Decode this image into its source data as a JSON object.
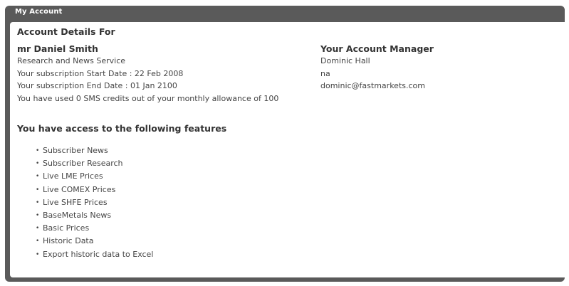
{
  "panel": {
    "header_title": "My Account"
  },
  "account": {
    "title": "Account Details For",
    "name": "mr Daniel Smith",
    "service": "Research and News Service",
    "start_date": "Your subscription Start Date : 22 Feb 2008",
    "end_date": "Your subscription End Date : 01 Jan 2100",
    "sms_credits": "You have used 0 SMS credits out of your monthly allowance of 100"
  },
  "manager": {
    "heading": "Your Account Manager",
    "name": "Dominic Hall",
    "phone": "na",
    "email": "dominic@fastmarkets.com"
  },
  "features": {
    "heading": "You have access to the following features",
    "items": [
      "Subscriber News",
      "Subscriber Research",
      "Live LME Prices",
      "Live COMEX Prices",
      "Live SHFE Prices",
      "BaseMetals News",
      "Basic Prices",
      "Historic Data",
      "Export historic data to Excel"
    ]
  }
}
